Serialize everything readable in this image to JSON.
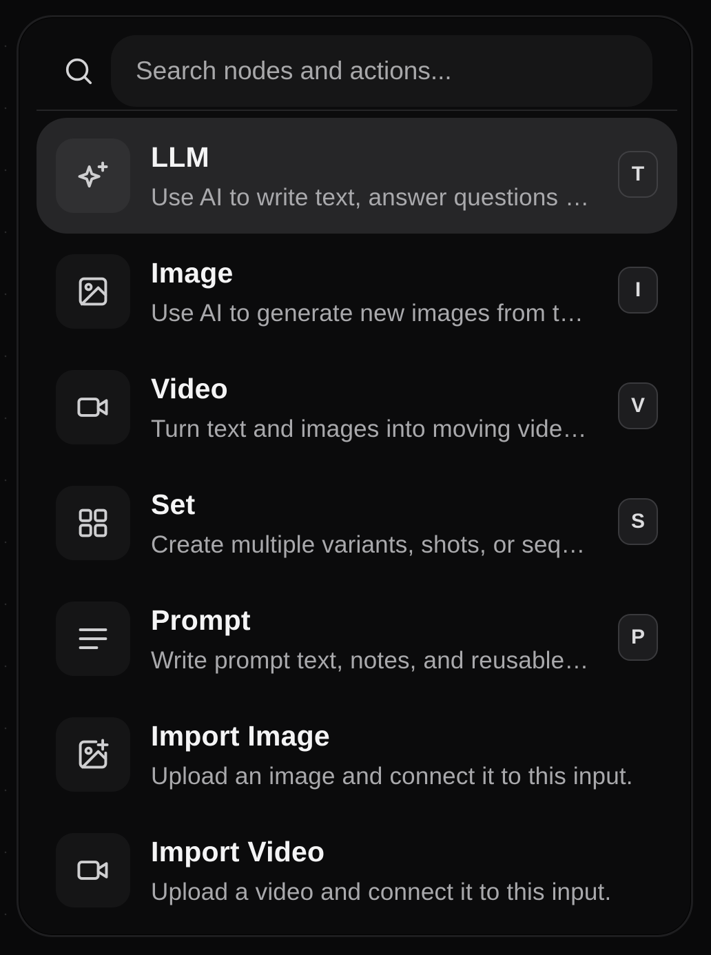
{
  "search": {
    "placeholder": "Search nodes and actions..."
  },
  "items": [
    {
      "title": "LLM",
      "description": "Use AI to write text, answer questions and more",
      "shortcut": "T",
      "icon": "sparkles-icon",
      "active": true
    },
    {
      "title": "Image",
      "description": "Use AI to generate new images from text and references",
      "shortcut": "I",
      "icon": "image-icon"
    },
    {
      "title": "Video",
      "description": "Turn text and images into moving video clips",
      "shortcut": "V",
      "icon": "video-icon"
    },
    {
      "title": "Set",
      "description": "Create multiple variants, shots, or sequences",
      "shortcut": "S",
      "icon": "grid-icon"
    },
    {
      "title": "Prompt",
      "description": "Write prompt text, notes, and reusable snippets",
      "shortcut": "P",
      "icon": "text-lines-icon"
    },
    {
      "title": "Import Image",
      "description": "Upload an image and connect it to this input.",
      "icon": "image-plus-icon"
    },
    {
      "title": "Import Video",
      "description": "Upload a video and connect it to this input.",
      "icon": "video-icon"
    }
  ],
  "colors": {
    "background": "#09090a",
    "panel": "#0b0b0c",
    "active_row": "#262628",
    "title_text": "#f4f4f5",
    "description_text": "#a9a9ac"
  }
}
